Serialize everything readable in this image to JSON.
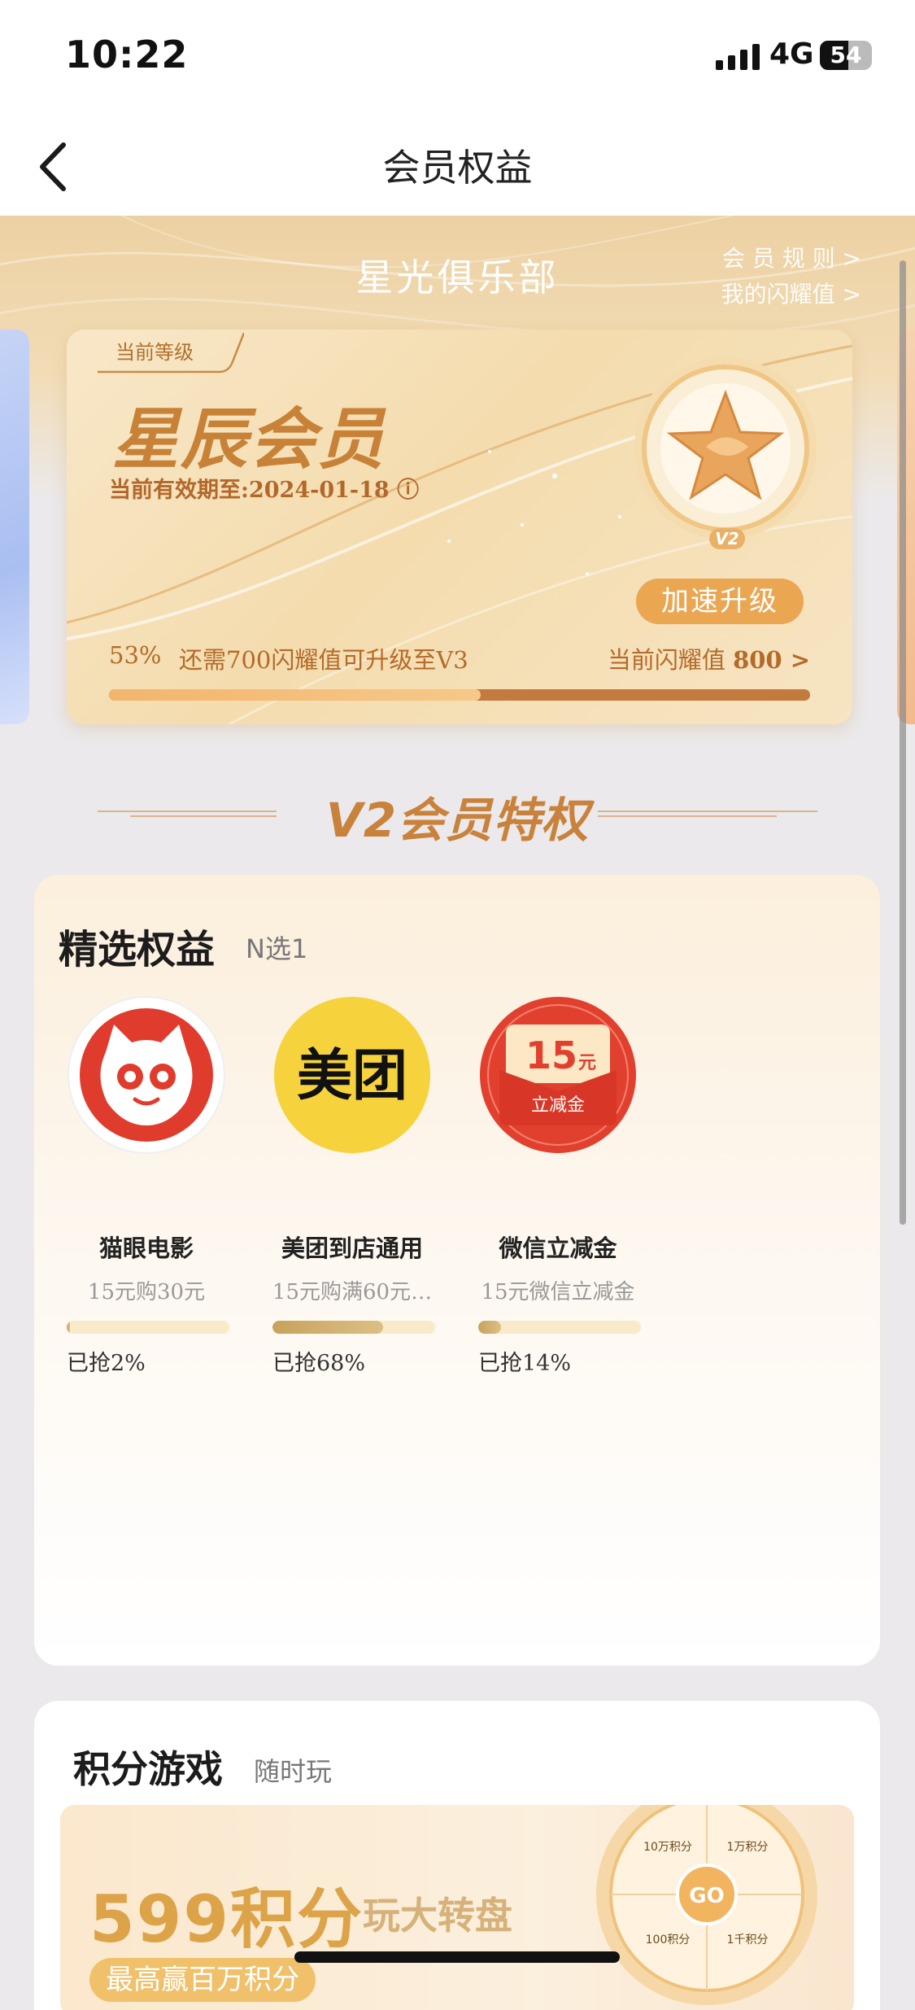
{
  "status_bar": {
    "time": "10:22",
    "network": "4G",
    "battery": "54",
    "battery_level": 0.54
  },
  "nav": {
    "title": "会员权益"
  },
  "club": {
    "title": "星光俱乐部",
    "rules_link": "会 员 规 则 >",
    "points_link": "我的闪耀值 >"
  },
  "card": {
    "tag": "当前等级",
    "level_name": "星辰会员",
    "valid_until": "当前有效期至:2024-01-18 ⓘ",
    "badge": "V2",
    "upgrade_button": "加速升级",
    "percent": "53%",
    "percent_value": 0.53,
    "need_text": "还需700闪耀值可升级至V3",
    "current_label": "当前闪耀值",
    "current_value": "800 >"
  },
  "privilege_title": "V2会员特权",
  "benefits": {
    "title": "精选权益",
    "subtitle": "N选1",
    "items": [
      {
        "name": "猫眼电影",
        "desc": "15元购30元",
        "progress": 0.02,
        "grabbed": "已抢2%",
        "icon": "maoyan-logo-icon",
        "color": "#e03c2e"
      },
      {
        "name": "美团到店通用",
        "desc": "15元购满60元…",
        "progress": 0.68,
        "grabbed": "已抢68%",
        "icon": "meituan-logo-icon",
        "color": "#f6d23d",
        "logo_text": "美团"
      },
      {
        "name": "微信立减金",
        "desc": "15元微信立减金",
        "progress": 0.14,
        "grabbed": "已抢14%",
        "icon": "wechat-coupon-icon",
        "color": "#e2402f",
        "logo_amount": "15",
        "logo_unit": "元",
        "logo_label": "立减金"
      }
    ]
  },
  "game": {
    "title": "积分游戏",
    "subtitle": "随时玩",
    "banner_big": "599积分",
    "banner_play": "玩大转盘",
    "banner_pill": "最高赢百万积分",
    "wheel_center": "GO",
    "wheel_labels": [
      "1万积分",
      "10万积分",
      "1千积分",
      "100积分"
    ]
  }
}
